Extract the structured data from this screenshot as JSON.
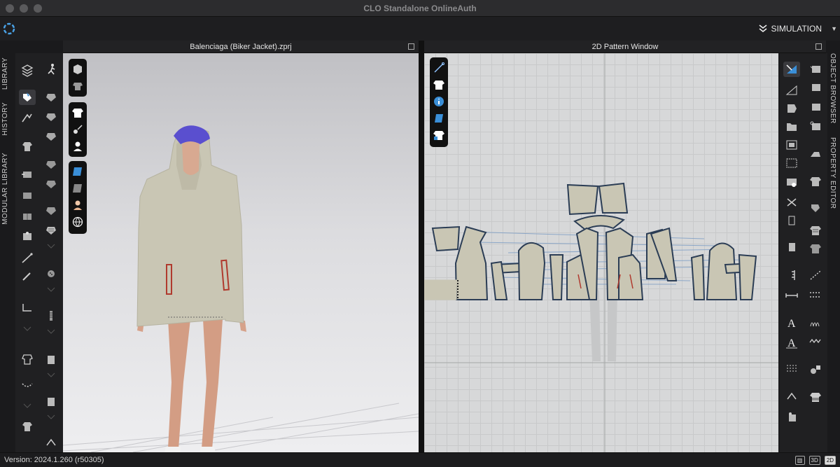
{
  "window": {
    "title": "CLO Standalone OnlineAuth"
  },
  "menubar": {
    "mode_label": "SIMULATION"
  },
  "left_tabs": [
    "LIBRARY",
    "HISTORY",
    "MODULAR LIBRARY"
  ],
  "right_tabs": [
    "OBJECT BROWSER",
    "PROPERTY EDITOR"
  ],
  "panel3d": {
    "title": "Balenciaga (Biker Jacket).zprj"
  },
  "panel2d": {
    "title": "2D Pattern Window"
  },
  "status": {
    "version": "Version: 2024.1.260 (r50305)",
    "view_buttons": [
      "3D",
      "2D"
    ]
  },
  "colors": {
    "fabric": "#c9c6b4",
    "seam_line": "#3d5a80",
    "pocket": "#b03a2e",
    "hair": "#5a4fcf"
  }
}
